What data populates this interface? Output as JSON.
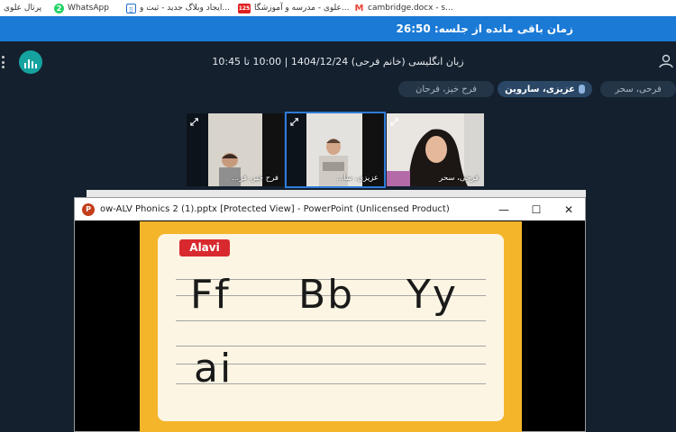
{
  "bookmarks": [
    {
      "label": "پرتال علوی",
      "icon": "portal-icon",
      "color": "#d33"
    },
    {
      "label": "WhatsApp",
      "icon": "whatsapp-icon",
      "color": "#25d366",
      "badge": "2"
    },
    {
      "label": "ایجاد وبلاگ جدید - ثبت و...",
      "icon": "blog-icon",
      "color": "#1e6fd0"
    },
    {
      "label": "علوی - مدرسه و آموزشگا...",
      "icon": "school-icon",
      "color": "#e02020",
      "badge": "125"
    },
    {
      "label": "cambridge.docx - s...",
      "icon": "gmail-icon",
      "color": "#ea4335",
      "badge": "M"
    }
  ],
  "timer": {
    "text": "زمان باقی مانده از جلسه: 26:50"
  },
  "header": {
    "title": "زبان انگلیسی (خانم فرحی) 1404/12/24 | 10:00 تا 10:45"
  },
  "chips": [
    {
      "label": "فرحی، سحر",
      "active": false
    },
    {
      "label": "عزیزی، ساروین",
      "active": true
    },
    {
      "label": "فرح خیز، فرحان",
      "active": false
    }
  ],
  "tiles": [
    {
      "name": "فرح خیز، فر...",
      "expand_glyph": "⤢"
    },
    {
      "name": "عزیزی، سا...",
      "expand_glyph": "⤢"
    },
    {
      "name": "فرحی، سحر",
      "expand_glyph": "⤢"
    }
  ],
  "ppt": {
    "title": "ow-ALV Phonics 2 (1).pptx [Protected View] - PowerPoint (Unlicensed Product)",
    "minimize": "—",
    "maximize": "☐",
    "close": "✕",
    "logo_letter": "P"
  },
  "slide": {
    "badge": "Alavi",
    "words_line1": [
      "Ff",
      "Bb",
      "Yy"
    ],
    "words_line2": [
      "ai"
    ]
  },
  "colors": {
    "timer_bar": "#1a7ad6",
    "accent": "#16a3a0",
    "slide_border": "#f4b52a",
    "badge": "#d8292f"
  }
}
